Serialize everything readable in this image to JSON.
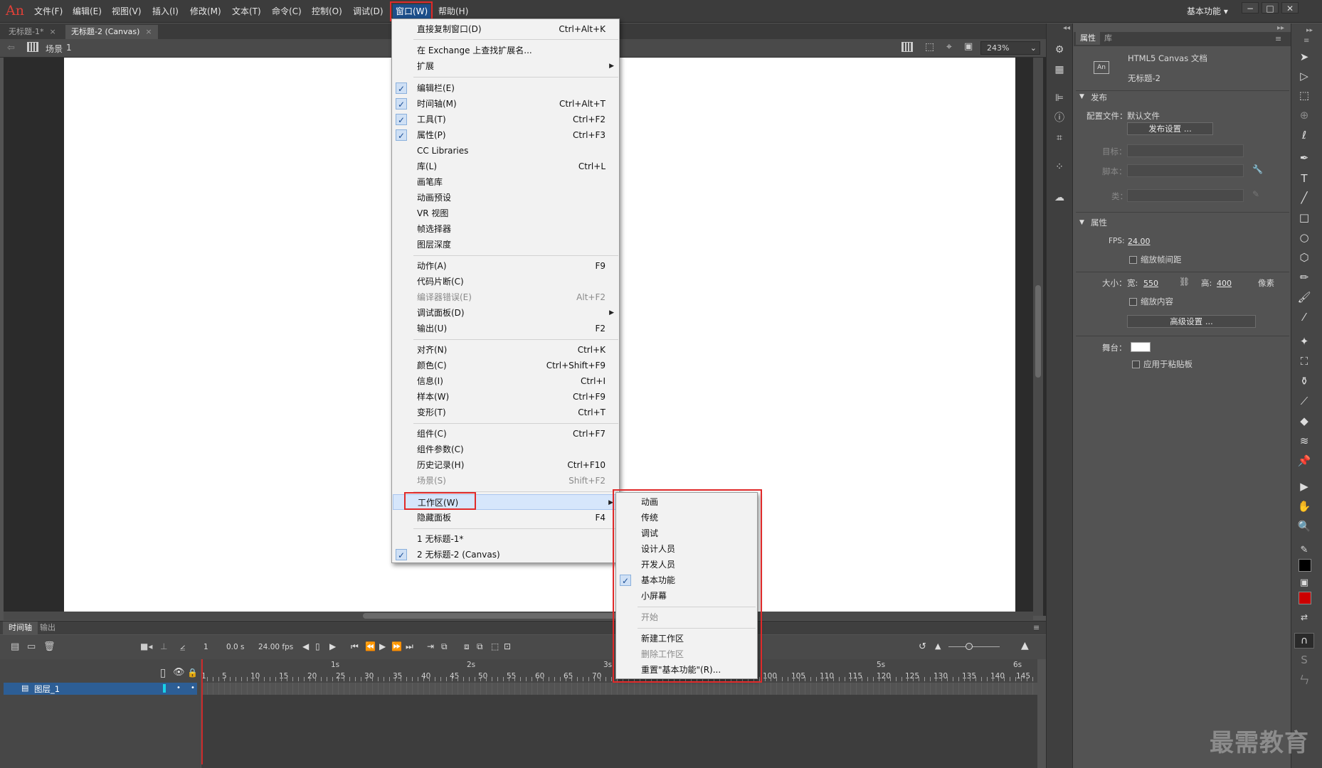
{
  "app": {
    "logo": "An"
  },
  "menubar": {
    "items": [
      "文件(F)",
      "编辑(E)",
      "视图(V)",
      "插入(I)",
      "修改(M)",
      "文本(T)",
      "命令(C)",
      "控制(O)",
      "调试(D)",
      "窗口(W)",
      "帮助(H)"
    ],
    "workspace": "基本功能",
    "window_buttons": [
      "−",
      "□",
      "✕"
    ]
  },
  "tabs": [
    {
      "label": "无标题-1*",
      "close": "×"
    },
    {
      "label": "无标题-2 (Canvas)",
      "close": "×"
    }
  ],
  "scenebar": {
    "scene_label": "场景",
    "scene_number": "1",
    "zoom": "243%"
  },
  "window_menu": {
    "items": [
      {
        "label": "直接复制窗口(D)",
        "shortcut": "Ctrl+Alt+K"
      },
      {
        "label": "在 Exchange 上查找扩展名..."
      },
      {
        "label": "扩展",
        "submenu": "▶"
      },
      {
        "label": "编辑栏(E)",
        "check": "✓"
      },
      {
        "label": "时间轴(M)",
        "shortcut": "Ctrl+Alt+T",
        "check": "✓"
      },
      {
        "label": "工具(T)",
        "shortcut": "Ctrl+F2",
        "check": "✓"
      },
      {
        "label": "属性(P)",
        "shortcut": "Ctrl+F3",
        "check": "✓"
      },
      {
        "label": "CC Libraries"
      },
      {
        "label": "库(L)",
        "shortcut": "Ctrl+L"
      },
      {
        "label": "画笔库"
      },
      {
        "label": "动画预设"
      },
      {
        "label": "VR 视图"
      },
      {
        "label": "帧选择器"
      },
      {
        "label": "图层深度"
      },
      {
        "label": "动作(A)",
        "shortcut": "F9"
      },
      {
        "label": "代码片断(C)"
      },
      {
        "label": "编译器错误(E)",
        "shortcut": "Alt+F2"
      },
      {
        "label": "调试面板(D)",
        "submenu": "▶"
      },
      {
        "label": "输出(U)",
        "shortcut": "F2"
      },
      {
        "label": "对齐(N)",
        "shortcut": "Ctrl+K"
      },
      {
        "label": "颜色(C)",
        "shortcut": "Ctrl+Shift+F9"
      },
      {
        "label": "信息(I)",
        "shortcut": "Ctrl+I"
      },
      {
        "label": "样本(W)",
        "shortcut": "Ctrl+F9"
      },
      {
        "label": "变形(T)",
        "shortcut": "Ctrl+T"
      },
      {
        "label": "组件(C)",
        "shortcut": "Ctrl+F7"
      },
      {
        "label": "组件参数(C)"
      },
      {
        "label": "历史记录(H)",
        "shortcut": "Ctrl+F10"
      },
      {
        "label": "场景(S)",
        "shortcut": "Shift+F2"
      },
      {
        "label": "工作区(W)",
        "submenu": "▶"
      },
      {
        "label": "隐藏面板",
        "shortcut": "F4"
      },
      {
        "label": "1 无标题-1*"
      },
      {
        "label": "2 无标题-2 (Canvas)",
        "check": "✓"
      }
    ]
  },
  "workspace_submenu": {
    "items": [
      {
        "label": "动画"
      },
      {
        "label": "传统"
      },
      {
        "label": "调试"
      },
      {
        "label": "设计人员"
      },
      {
        "label": "开发人员"
      },
      {
        "label": "基本功能",
        "check": "✓"
      },
      {
        "label": "小屏幕"
      },
      {
        "label": "开始"
      },
      {
        "label": "新建工作区"
      },
      {
        "label": "删除工作区"
      },
      {
        "label": "重置\"基本功能\"(R)..."
      }
    ]
  },
  "properties": {
    "tabs": [
      "属性",
      "库"
    ],
    "doc_icon": "An",
    "doc_type": "HTML5 Canvas 文档",
    "doc_name": "无标题-2",
    "publish_section": "发布",
    "profile_label": "配置文件：",
    "profile_value": "默认文件",
    "publish_settings_btn": "发布设置 ...",
    "target_label": "目标：",
    "script_label": "脚本：",
    "class_label": "类：",
    "props_section": "属性",
    "fps_label": "FPS:",
    "fps_value": "24.00",
    "scale_spans": "缩放帧间距",
    "size_label": "大小：",
    "width_label": "宽:",
    "width_value": "550",
    "height_label": "高:",
    "height_value": "400",
    "unit": "像素",
    "scale_content": "缩放内容",
    "advanced_btn": "高级设置 ...",
    "stage_label": "舞台：",
    "stage_color": "#ffffff",
    "apply_pasteboard": "应用于粘贴板"
  },
  "timeline": {
    "tabs": [
      "时间轴",
      "输出"
    ],
    "frame": "1",
    "time": "0.0 s",
    "fps": "24.00 fps",
    "layer_name": "图层_1",
    "seconds": [
      "1s",
      "2s",
      "3s",
      "5s",
      "6s"
    ],
    "ticks": [
      "1",
      "5",
      "10",
      "15",
      "20",
      "25",
      "30",
      "35",
      "40",
      "45",
      "50",
      "55",
      "60",
      "65",
      "70",
      "100",
      "105",
      "110",
      "115",
      "120",
      "125",
      "130",
      "135",
      "140",
      "145"
    ]
  },
  "watermark": "最需教育",
  "colors": {
    "accent_red": "#e02a2a",
    "highlight": "#1c4e8a",
    "fill_color": "#cc0000"
  }
}
